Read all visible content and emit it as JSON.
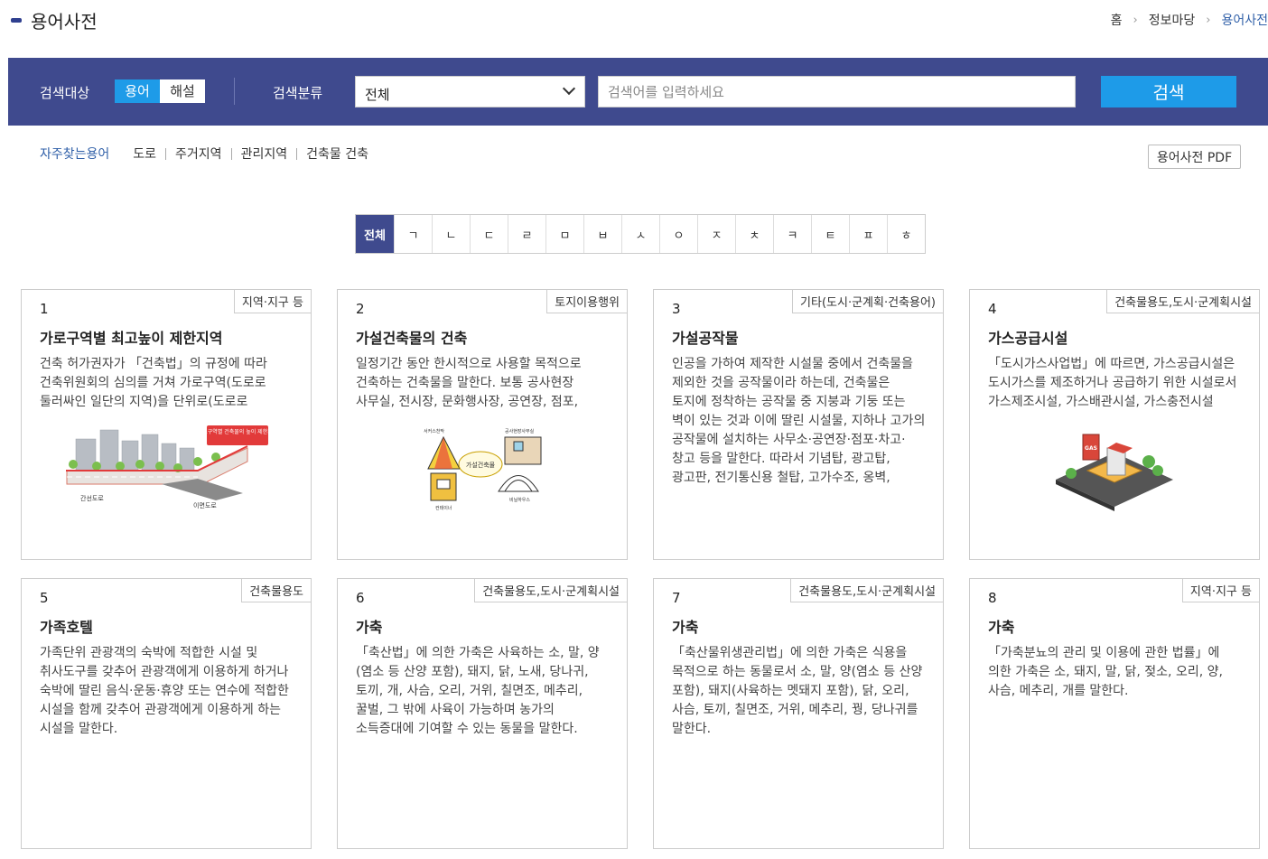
{
  "page": {
    "title": "용어사전"
  },
  "breadcrumb": [
    "홈",
    "정보마당",
    "용어사전"
  ],
  "search": {
    "target_label": "검색대상",
    "target_options": [
      "용어",
      "해설"
    ],
    "category_label": "검색분류",
    "category_value": "전체",
    "placeholder": "검색어를 입력하세요",
    "button_label": "검색"
  },
  "frequent": {
    "label": "자주찾는용어",
    "terms": [
      "도로",
      "주거지역",
      "관리지역",
      "건축물 건축"
    ]
  },
  "pdf_button": "용어사전 PDF",
  "alphabet": [
    "전체",
    "ㄱ",
    "ㄴ",
    "ㄷ",
    "ㄹ",
    "ㅁ",
    "ㅂ",
    "ㅅ",
    "ㅇ",
    "ㅈ",
    "ㅊ",
    "ㅋ",
    "ㅌ",
    "ㅍ",
    "ㅎ"
  ],
  "cards": [
    {
      "num": "1",
      "tag": "지역·지구 등",
      "title": "가로구역별 최고높이 제한지역",
      "desc": "건축 허가권자가 「건축법」의 규정에 따라 건축위원회의 심의를 거쳐 가로구역(도로로 둘러싸인 일단의 지역)을 단위로(도로로 둘러싸인 일단의 지역)",
      "image": {
        "callout": "가로구역별 건축물의 높이 제한지역",
        "label_left": "간선도로",
        "label_bottom": "이면도로"
      }
    },
    {
      "num": "2",
      "tag": "토지이용행위",
      "title": "가설건축물의 건축",
      "desc": "일정기간 동안 한시적으로 사용할 목적으로 건축하는 건축물을 말한다. 보통 공사현장 사무실, 전시장, 문화행사장, 공연장, 점포, 판매시설 등이 있다.",
      "image": {
        "center": "가설건축물",
        "label_a": "서커스천막",
        "label_b": "비닐하우스",
        "label_c": "컨테이너",
        "label_d": "공사현장사무실"
      }
    },
    {
      "num": "3",
      "tag": "기타(도시·군계획·건축용어)",
      "title": "가설공작물",
      "desc": "인공을 가하여 제작한 시설물 중에서 건축물을 제외한 것을 공작물이라 하는데, 건축물은 토지에 정착하는 공작물 중 지붕과 기둥 또는 벽이 있는 것과 이에 딸린 시설물, 지하나 고가의 공작물에 설치하는 사무소·공연장·점포·차고·창고 등을 말한다. 따라서 기념탑, 광고탑, 광고판, 전기통신용 철탑, 고가수조, 옹벽,"
    },
    {
      "num": "4",
      "tag": "건축물용도,도시·군계획시설",
      "title": "가스공급시설",
      "desc": "「도시가스사업법」에 따르면, 가스공급시설은 도시가스를 제조하거나 공급하기 위한 시설로서 가스제조시설, 가스배관시설, 가스충전시설",
      "image": {
        "sign": "GAS"
      }
    },
    {
      "num": "5",
      "tag": "건축물용도",
      "title": "가족호텔",
      "desc": "가족단위 관광객의 숙박에 적합한 시설 및 취사도구를 갖추어 관광객에게 이용하게 하거나 숙박에 딸린 음식·운동·휴양 또는 연수에 적합한 시설을 함께 갖추어 관광객에게 이용하게 하는 시설을 말한다."
    },
    {
      "num": "6",
      "tag": "건축물용도,도시·군계획시설",
      "title": "가축",
      "desc": "「축산법」에 의한 가축은 사육하는 소, 말, 양(염소 등 산양 포함), 돼지, 닭, 노새, 당나귀, 토끼, 개, 사슴, 오리, 거위, 칠면조, 메추리, 꿀벌, 그 밖에 사육이 가능하며 농가의 소득증대에 기여할 수 있는 동물을 말한다."
    },
    {
      "num": "7",
      "tag": "건축물용도,도시·군계획시설",
      "title": "가축",
      "desc": "「축산물위생관리법」에 의한 가축은 식용을 목적으로 하는 동물로서 소, 말, 양(염소 등 산양 포함), 돼지(사육하는 멧돼지 포함), 닭, 오리, 사슴, 토끼, 칠면조, 거위, 메추리, 꿩, 당나귀를 말한다."
    },
    {
      "num": "8",
      "tag": "지역·지구 등",
      "title": "가축",
      "desc": "「가축분뇨의 관리 및 이용에 관한 법률」에 의한 가축은 소, 돼지, 말, 닭, 젖소, 오리, 양, 사슴, 메추리, 개를 말한다."
    }
  ]
}
